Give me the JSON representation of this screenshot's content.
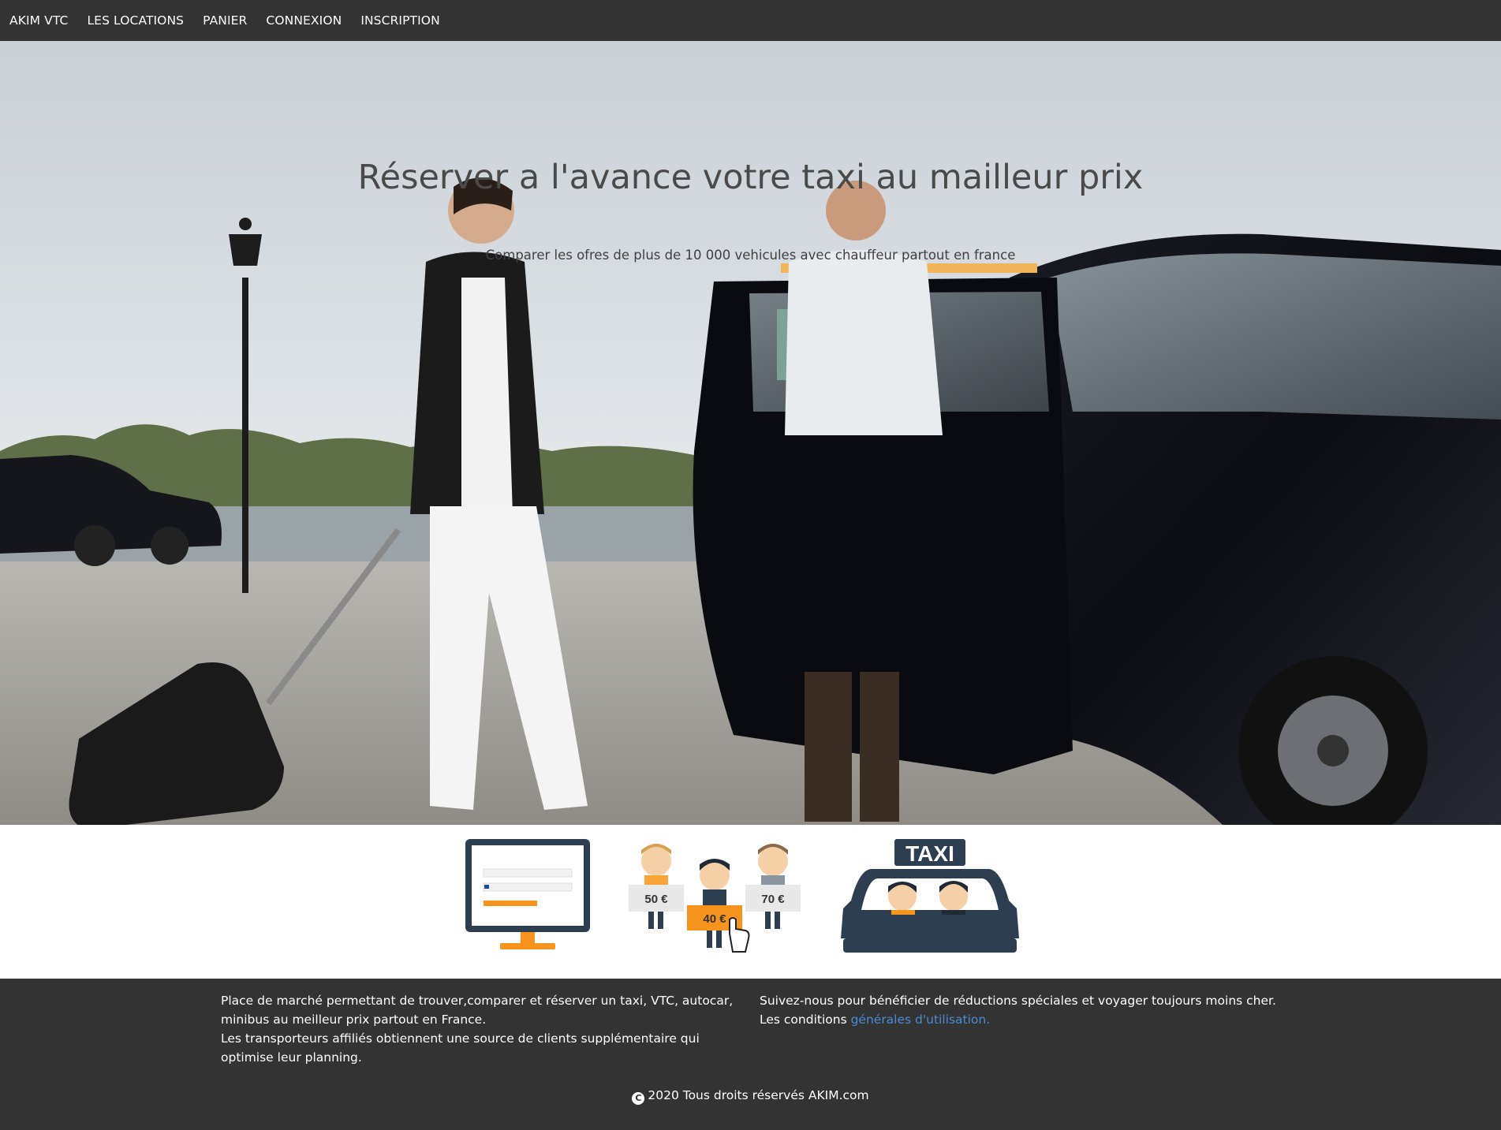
{
  "nav": {
    "brand": "AKIM VTC",
    "items": [
      "LES LOCATIONS",
      "PANIER",
      "CONNEXION",
      "INSCRIPTION"
    ]
  },
  "hero": {
    "title": "Réserver a l'avance votre taxi au mailleur prix",
    "subtitle": "Comparer les ofres de plus de 10 000 vehicules avec chauffeur partout en france"
  },
  "features": {
    "compare_prices": [
      "50 €",
      "40 €",
      "70 €"
    ],
    "taxi_sign": "TAXI"
  },
  "footer": {
    "left_line1": "Place de marché permettant de trouver,comparer et réserver un taxi, VTC, autocar, minibus au meilleur prix partout en France.",
    "left_line2": "Les transporteurs affiliés obtiennent une source de clients supplémentaire qui optimise leur planning.",
    "right_line1": "Suivez-nous pour bénéficier de réductions spéciales et voyager toujours moins cher.",
    "right_line2_prefix": "Les conditions ",
    "right_line2_link": "générales d'utilisation.",
    "copyright": "2020 Tous droits réservés AKIM.com"
  },
  "colors": {
    "nav_bg": "#333333",
    "footer_bg": "#333333",
    "link": "#4a8bd4",
    "accent_orange": "#f7941d",
    "icon_navy": "#2d3e50"
  }
}
